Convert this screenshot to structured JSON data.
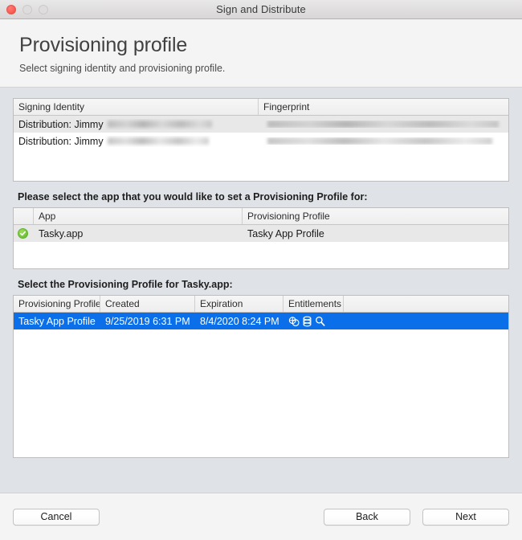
{
  "window": {
    "title": "Sign and Distribute",
    "traffic_lights": [
      "close",
      "minimize",
      "maximize"
    ]
  },
  "header": {
    "title": "Provisioning profile",
    "subtitle": "Select signing identity and provisioning profile."
  },
  "signing_identity_table": {
    "columns": [
      "Signing Identity",
      "Fingerprint"
    ],
    "rows": [
      {
        "identity": "Distribution: Jimmy",
        "identity_redacted": true,
        "fingerprint": "",
        "fingerprint_redacted": true
      },
      {
        "identity": "Distribution: Jimmy",
        "identity_redacted": true,
        "fingerprint": "",
        "fingerprint_redacted": true
      }
    ]
  },
  "app_section": {
    "label": "Please select the app that you would like to set a Provisioning Profile for:",
    "columns": [
      "",
      "App",
      "Provisioning Profile"
    ],
    "rows": [
      {
        "status_icon": "green-check-icon",
        "app": "Tasky.app",
        "profile": "Tasky App Profile",
        "selected": true
      }
    ]
  },
  "profile_section": {
    "label": "Select the Provisioning Profile for Tasky.app:",
    "columns": [
      "Provisioning Profile",
      "Created",
      "Expiration",
      "Entitlements",
      ""
    ],
    "rows": [
      {
        "profile": "Tasky App Profile",
        "created": "9/25/2019 6:31 PM",
        "expiration": "8/4/2020 8:24 PM",
        "entitlements": [
          "app-groups-icon",
          "data-store-icon",
          "search-icon"
        ],
        "selected": true
      }
    ]
  },
  "footer": {
    "cancel_label": "Cancel",
    "back_label": "Back",
    "next_label": "Next"
  },
  "colors": {
    "selection_blue": "#0a6fe8",
    "check_green": "#72c53b",
    "body_background": "#dfe2e6",
    "header_background": "#f4f4f4"
  }
}
